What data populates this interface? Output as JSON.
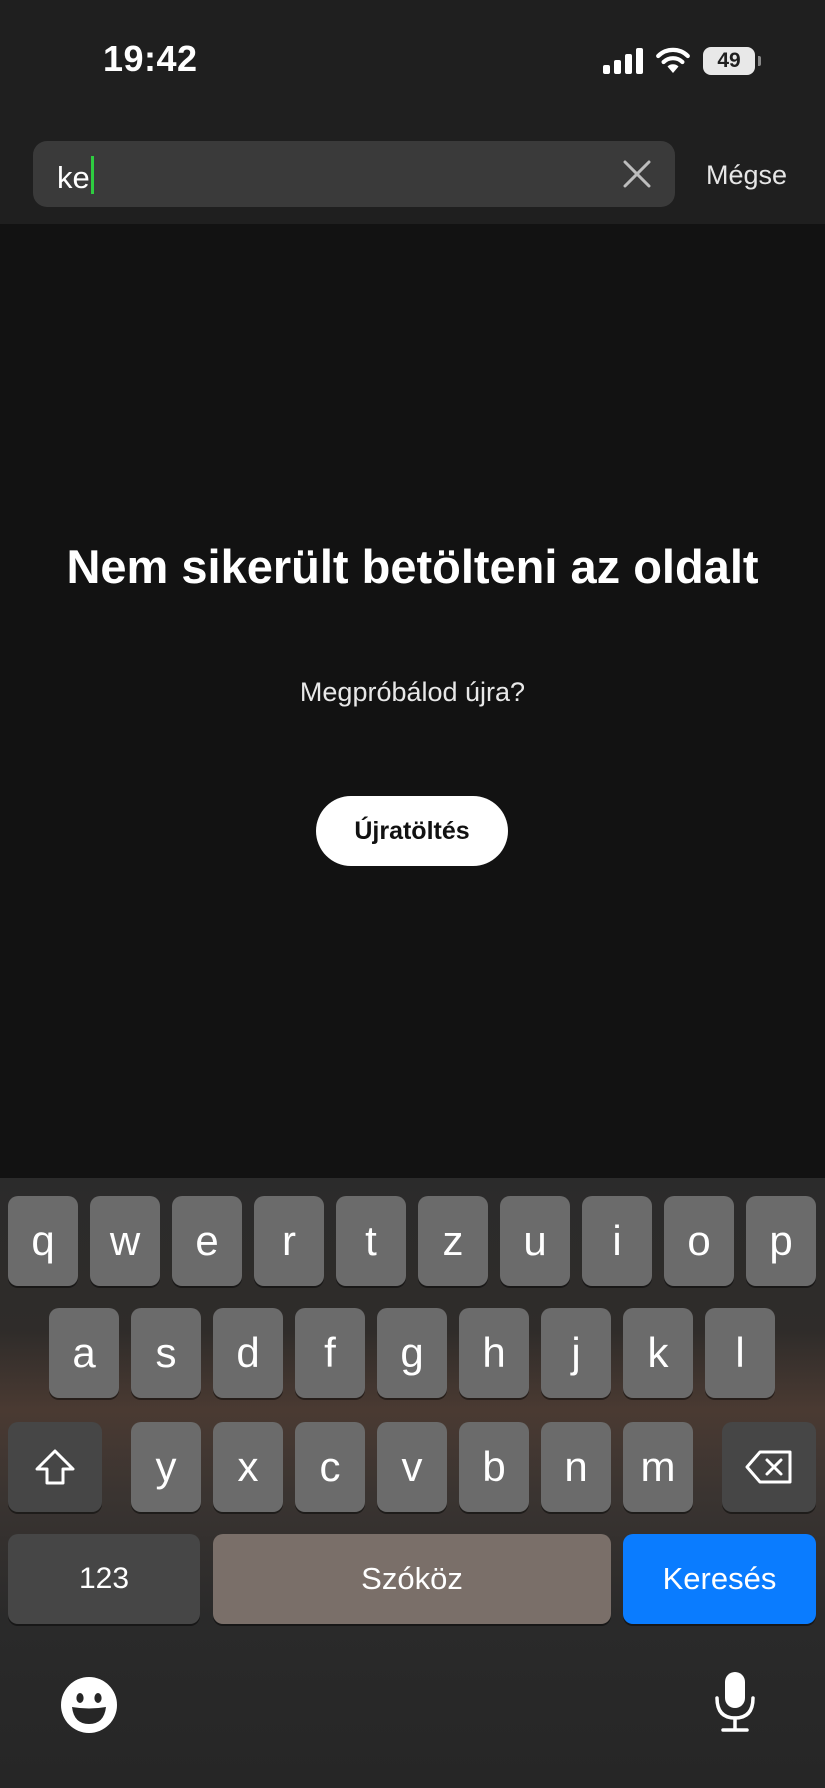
{
  "status_bar": {
    "time": "19:42",
    "battery": "49"
  },
  "search": {
    "value": "ke",
    "cancel_label": "Mégse"
  },
  "error": {
    "title": "Nem sikerült betölteni az oldalt",
    "subtitle": "Megpróbálod újra?",
    "reload_label": "Újratöltés"
  },
  "keyboard": {
    "row1": [
      "q",
      "w",
      "e",
      "r",
      "t",
      "z",
      "u",
      "i",
      "o",
      "p"
    ],
    "row2": [
      "a",
      "s",
      "d",
      "f",
      "g",
      "h",
      "j",
      "k",
      "l"
    ],
    "row3": [
      "y",
      "x",
      "c",
      "v",
      "b",
      "n",
      "m"
    ],
    "numbers_label": "123",
    "space_label": "Szóköz",
    "search_label": "Keresés",
    "icons": {
      "shift": "shift-icon",
      "backspace": "backspace-icon",
      "emoji": "emoji-icon",
      "mic": "microphone-icon",
      "clear": "close-icon",
      "wifi": "wifi-icon",
      "signal": "cellular-signal-icon",
      "battery": "battery-icon"
    }
  },
  "colors": {
    "accent": "#0a7cff",
    "caret": "#2ecc40",
    "background": "#121212"
  }
}
